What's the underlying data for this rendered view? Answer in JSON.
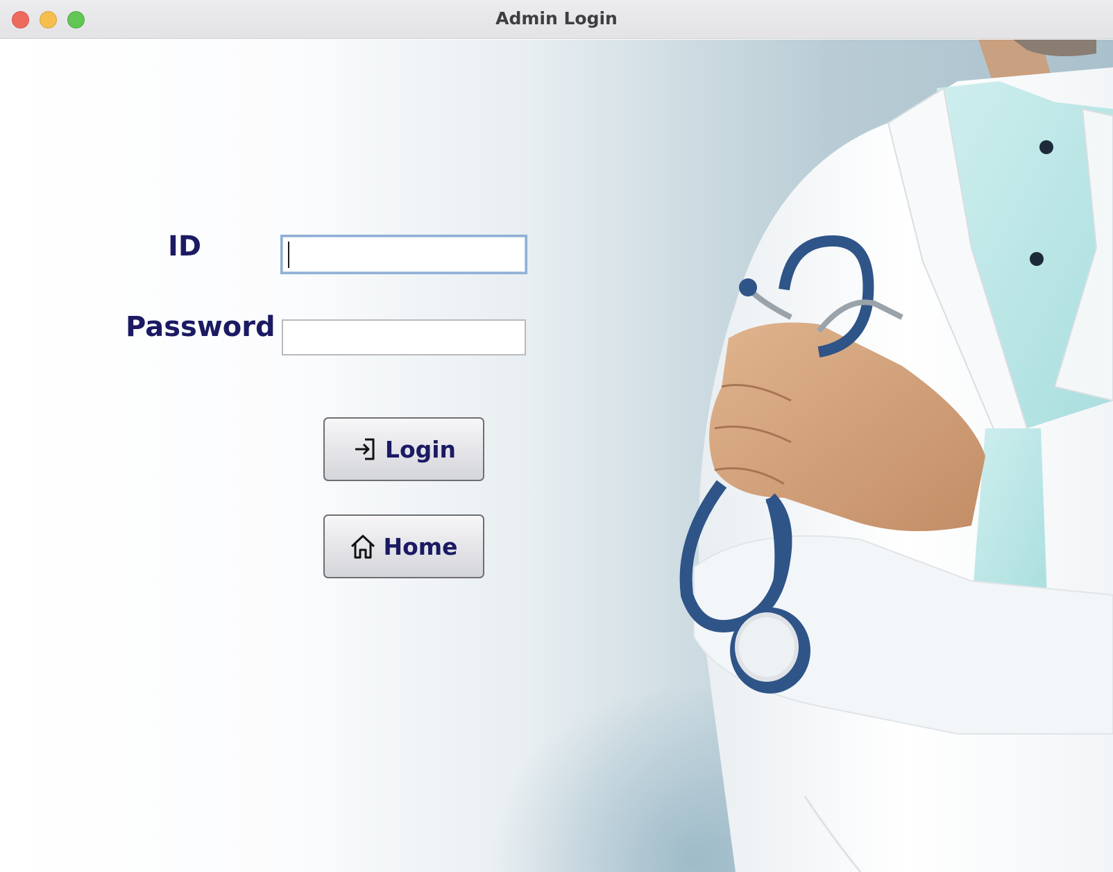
{
  "window": {
    "title": "Admin Login"
  },
  "form": {
    "id_label": "ID",
    "id_value": "",
    "password_label": "Password",
    "password_value": ""
  },
  "buttons": {
    "login_label": "Login",
    "login_icon": "login-enter-icon",
    "home_label": "Home",
    "home_icon": "home-icon"
  },
  "colors": {
    "label_text": "#1b1a63",
    "focus_ring": "#8fb0d6"
  }
}
